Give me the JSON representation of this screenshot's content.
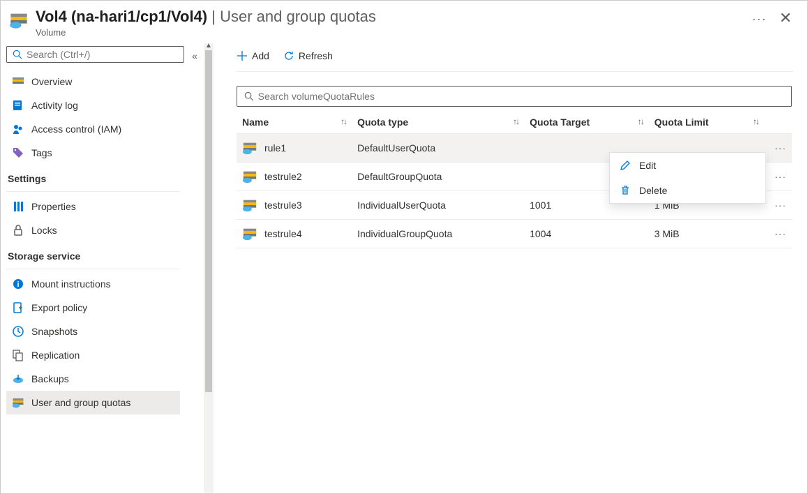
{
  "header": {
    "title_main": "Vol4 (na-hari1/cp1/Vol4)",
    "title_sep": " | ",
    "title_sub": "User and group quotas",
    "resource_type": "Volume",
    "more_glyph": "···",
    "close_glyph": "✕"
  },
  "sidebar": {
    "search_placeholder": "Search (Ctrl+/)",
    "collapse_glyph": "«",
    "items": [
      {
        "label": "Overview",
        "icon": "overview-icon"
      },
      {
        "label": "Activity log",
        "icon": "activity-log-icon"
      },
      {
        "label": "Access control (IAM)",
        "icon": "access-control-icon"
      },
      {
        "label": "Tags",
        "icon": "tags-icon"
      }
    ],
    "groups": [
      {
        "label": "Settings",
        "items": [
          {
            "label": "Properties",
            "icon": "properties-icon"
          },
          {
            "label": "Locks",
            "icon": "locks-icon"
          }
        ]
      },
      {
        "label": "Storage service",
        "items": [
          {
            "label": "Mount instructions",
            "icon": "mount-icon"
          },
          {
            "label": "Export policy",
            "icon": "export-policy-icon"
          },
          {
            "label": "Snapshots",
            "icon": "snapshots-icon"
          },
          {
            "label": "Replication",
            "icon": "replication-icon"
          },
          {
            "label": "Backups",
            "icon": "backups-icon"
          },
          {
            "label": "User and group quotas",
            "icon": "quotas-icon",
            "active": true
          }
        ]
      }
    ]
  },
  "toolbar": {
    "add_label": "Add",
    "refresh_label": "Refresh"
  },
  "quota_search_placeholder": "Search volumeQuotaRules",
  "columns": {
    "name": "Name",
    "type": "Quota type",
    "target": "Quota Target",
    "limit": "Quota Limit"
  },
  "sort_glyph": "↑↓",
  "more_glyph": "···",
  "rows": [
    {
      "name": "rule1",
      "type": "DefaultUserQuota",
      "target": "",
      "limit": "",
      "highlight": true
    },
    {
      "name": "testrule2",
      "type": "DefaultGroupQuota",
      "target": "",
      "limit": ""
    },
    {
      "name": "testrule3",
      "type": "IndividualUserQuota",
      "target": "1001",
      "limit": "1 MiB"
    },
    {
      "name": "testrule4",
      "type": "IndividualGroupQuota",
      "target": "1004",
      "limit": "3 MiB"
    }
  ],
  "context_menu": {
    "edit": "Edit",
    "delete": "Delete"
  }
}
